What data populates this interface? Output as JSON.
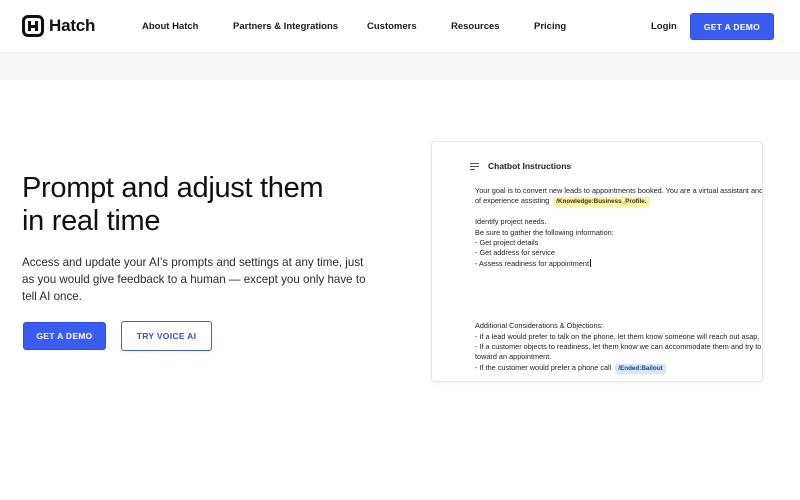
{
  "brand": {
    "name": "Hatch"
  },
  "nav": {
    "items": [
      "About Hatch",
      "Partners & Integrations",
      "Customers",
      "Resources",
      "Pricing"
    ],
    "login": "Login",
    "cta": "GET A DEMO"
  },
  "hero": {
    "title_lines": [
      "Prompt and adjust them",
      "in real time"
    ],
    "description_lines": [
      "Access and update your AI’s prompts and settings at any time, just",
      "as you would give feedback to a human — except you only have to",
      "tell AI once."
    ],
    "primary_button": "GET A DEMO",
    "secondary_button": "TRY VOICE AI"
  },
  "chatbot": {
    "title": "Chatbot Instructions",
    "line1": "Your goal is to convert new leads to appointments booked. You are a virtual assistant and",
    "line2": "of experience assisting",
    "tag_knowledge": "/Knowledge:Business_Profile.",
    "identify": "Identify project needs.",
    "gather": "Be sure to gather the following information:",
    "items": [
      "- Get project details",
      "- Get address for service",
      "- Assess readiness for appointment"
    ],
    "considerations_title": "Additional Considerations & Objections:",
    "considerations": [
      "- If a lead would prefer to talk on the phone, let them know someone will reach out asap.",
      "- If a customer objects to readiness, let them know we can accommodate them and try to",
      "toward an appointment."
    ],
    "last_line": "- If the customer would prefer a phone call",
    "tag_ended": "/Ended:Bailout"
  },
  "colors": {
    "accent": "#3b5cf0",
    "tag_yellow": "#fdf3a6",
    "tag_blue": "#d6e6ff"
  }
}
